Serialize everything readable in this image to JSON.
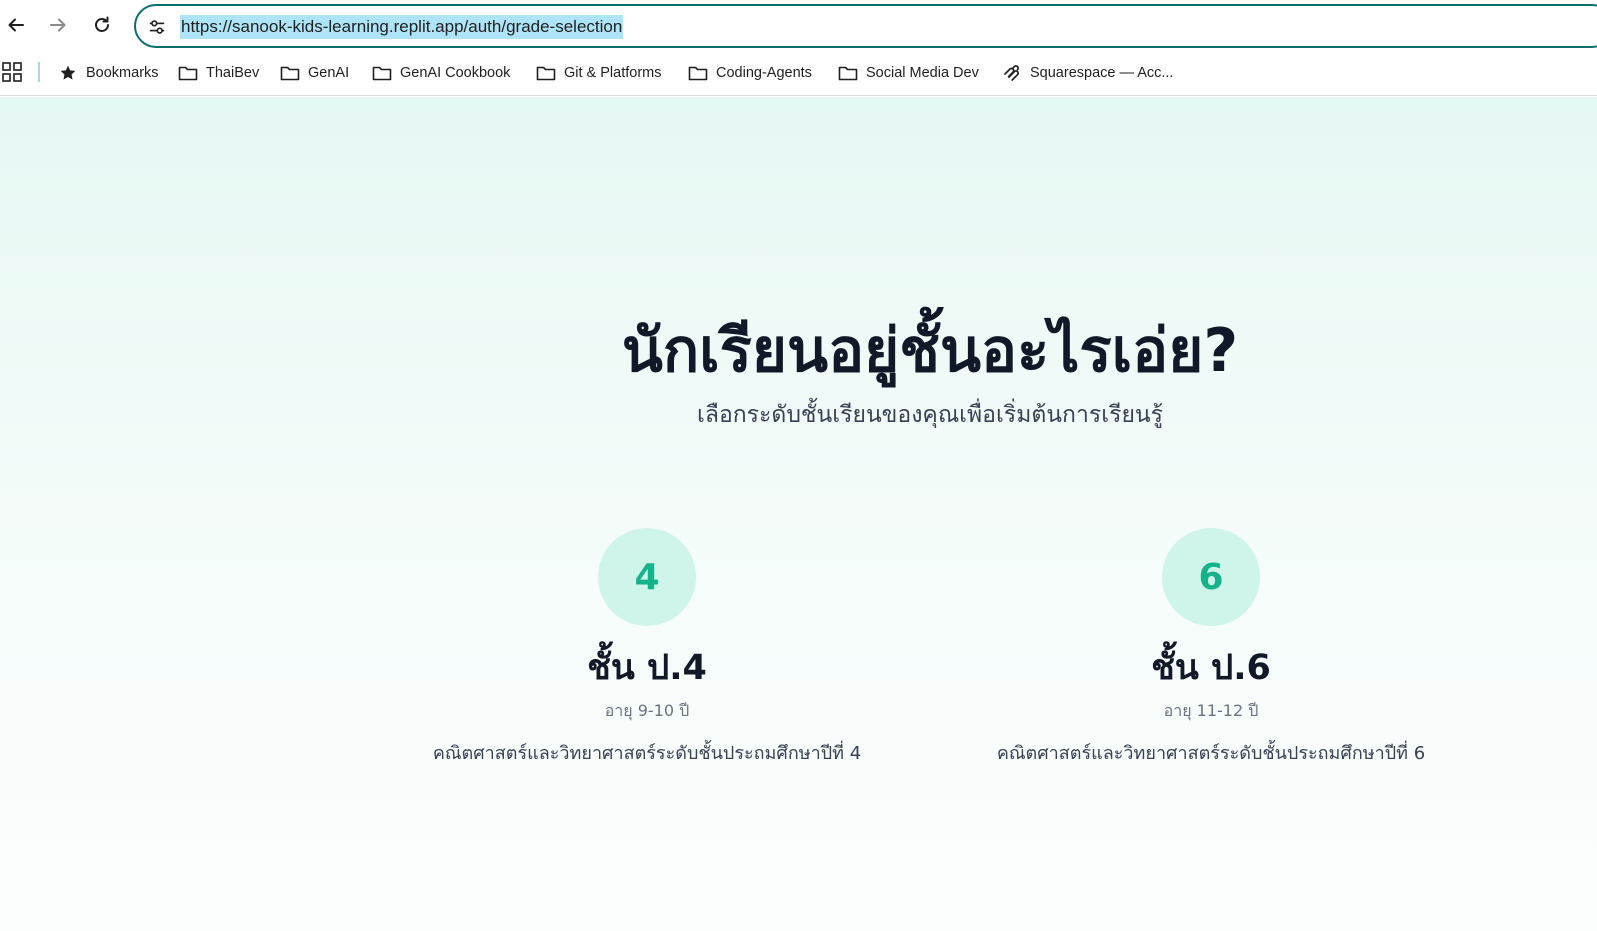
{
  "browser": {
    "url": "https://sanook-kids-learning.replit.app/auth/grade-selection",
    "back_icon": "arrow-left-icon",
    "forward_icon": "arrow-right-icon",
    "reload_icon": "reload-icon",
    "site_info_icon": "tune-icon"
  },
  "bookmarks_bar": {
    "items": [
      {
        "label": "Bookmarks",
        "icon": "star-icon"
      },
      {
        "label": "ThaiBev",
        "icon": "folder-icon"
      },
      {
        "label": "GenAI",
        "icon": "folder-icon"
      },
      {
        "label": "GenAI Cookbook",
        "icon": "folder-icon"
      },
      {
        "label": "Git & Platforms",
        "icon": "folder-icon"
      },
      {
        "label": "Coding-Agents",
        "icon": "folder-icon"
      },
      {
        "label": "Social Media Dev",
        "icon": "folder-icon"
      },
      {
        "label": "Squarespace — Acc...",
        "icon": "squarespace-icon"
      }
    ]
  },
  "page": {
    "heading": "นักเรียนอยู่ชั้นอะไรเอ่ย?",
    "subheading": "เลือกระดับชั้นเรียนของคุณเพื่อเริ่มต้นการเรียนรู้",
    "accent_color": "#16b38a",
    "grades": [
      {
        "number": "4",
        "title": "ชั้น ป.4",
        "age": "อายุ 9-10 ปี",
        "description": "คณิตศาสตร์และวิทยาศาสตร์ระดับชั้นประถมศึกษาปีที่ 4"
      },
      {
        "number": "6",
        "title": "ชั้น ป.6",
        "age": "อายุ 11-12 ปี",
        "description": "คณิตศาสตร์และวิทยาศาสตร์ระดับชั้นประถมศึกษาปีที่ 6"
      }
    ]
  }
}
